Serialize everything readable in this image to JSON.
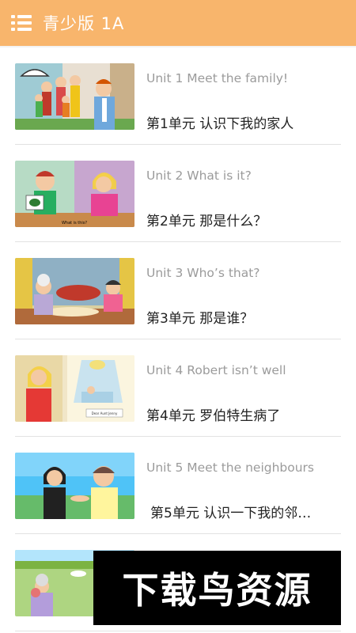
{
  "header": {
    "title": "青少版 1A",
    "menu_icon": "menu-list-icon",
    "background_color": "#f8b56c"
  },
  "units": [
    {
      "english": "Unit 1 Meet the family!",
      "chinese": "第1单元 认识下我的家人"
    },
    {
      "english": "Unit 2 What is it?",
      "chinese": "第2单元 那是什么？",
      "thumb_caption": "What is this?"
    },
    {
      "english": "Unit 3 Who’s that?",
      "chinese": "第3单元 那是谁？"
    },
    {
      "english": "Unit 4 Robert isn’t well",
      "chinese": "第4单元 罗伯特生病了",
      "thumb_caption": "Dear Aunt Jenny"
    },
    {
      "english": "Unit 5 Meet the neighbours",
      "chinese": "第5单元 认识一下我的邻…"
    },
    {
      "english": "",
      "chinese": ""
    }
  ],
  "watermark": {
    "text": "下载鸟资源"
  }
}
